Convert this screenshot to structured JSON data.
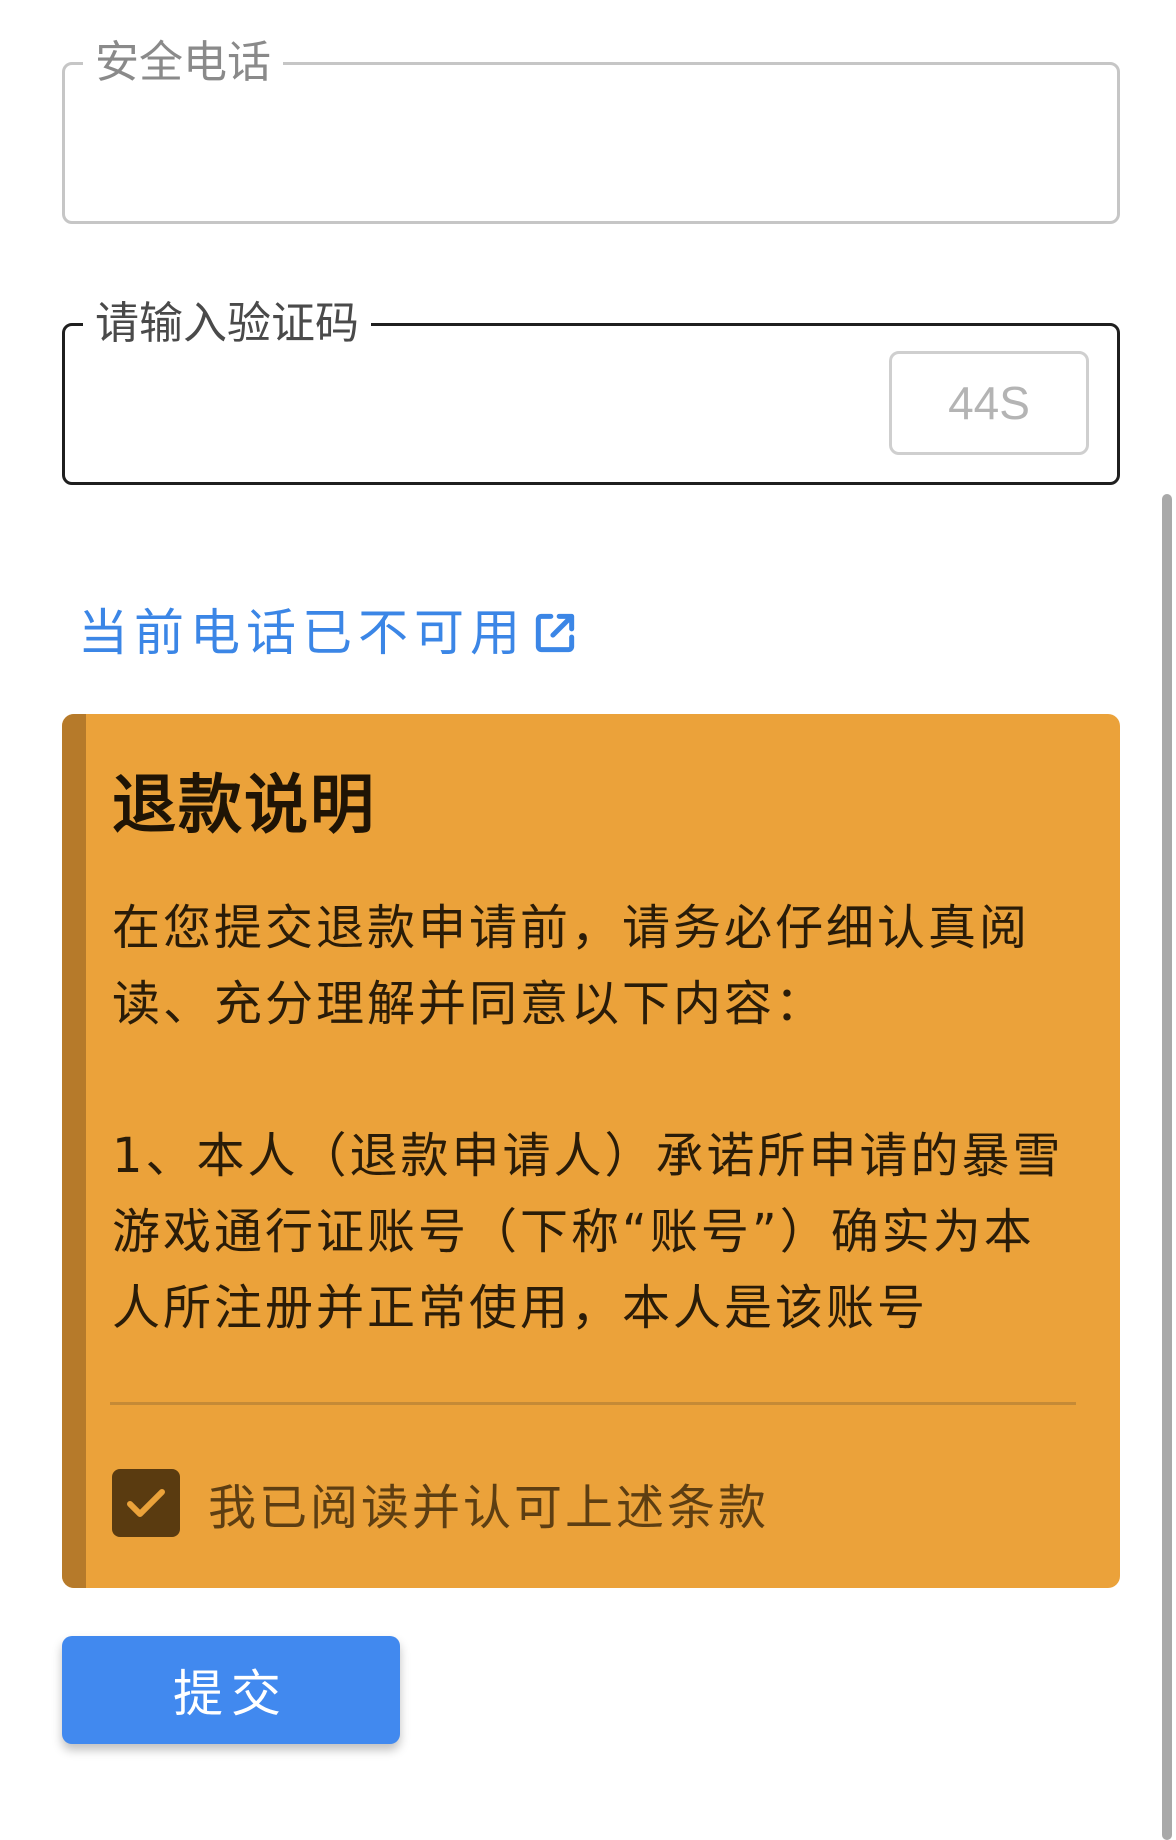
{
  "form": {
    "phone_label": "安全电话",
    "phone_value": "",
    "code_label": "请输入验证码",
    "code_value": "",
    "countdown": "44S"
  },
  "link": {
    "label": "当前电话已不可用",
    "icon": "external-link-icon",
    "color": "#3b86e6"
  },
  "notice": {
    "title": "退款说明",
    "paragraph_1": "在您提交退款申请前，请务必仔细认真阅读、充分理解并同意以下内容：",
    "paragraph_2": "1、本人（退款申请人）承诺所申请的暴雪游戏通行证账号（下称“账号”）确实为本人所注册并正常使用，本人是该账号",
    "agree_label": "我已阅读并认可上述条款",
    "agree_checked": true,
    "background": "#eba23a",
    "accent": "#b67a2a"
  },
  "submit": {
    "label": "提交",
    "color": "#4189ef"
  }
}
